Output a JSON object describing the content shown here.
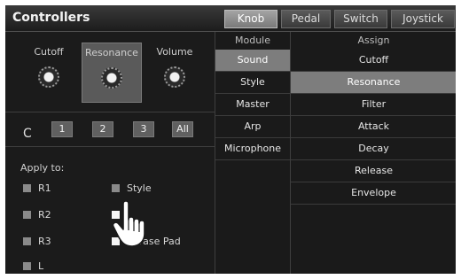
{
  "window": {
    "title": "Controllers"
  },
  "tabs": [
    {
      "label": "Knob",
      "active": true
    },
    {
      "label": "Pedal",
      "active": false
    },
    {
      "label": "Switch",
      "active": false
    },
    {
      "label": "Joystick",
      "active": false
    }
  ],
  "knobs": [
    {
      "label": "Cutoff",
      "selected": false
    },
    {
      "label": "Resonance",
      "selected": true
    },
    {
      "label": "Volume",
      "selected": false
    }
  ],
  "presets": {
    "reset_icon": "C",
    "buttons": [
      "1",
      "2",
      "3",
      "All"
    ]
  },
  "apply": {
    "label": "Apply to:",
    "options": [
      {
        "label": "R1",
        "checked": false
      },
      {
        "label": "Style",
        "checked": false
      },
      {
        "label": "R2",
        "checked": false
      },
      {
        "label": "",
        "checked": false
      },
      {
        "label": "R3",
        "checked": false
      },
      {
        "label": "Phrase Pad",
        "checked": false
      },
      {
        "label": "L",
        "checked": false
      }
    ]
  },
  "assign_table": {
    "module_header": "Module",
    "assign_header": "Assign",
    "modules": [
      "Sound",
      "Style",
      "Master",
      "Arp",
      "Microphone"
    ],
    "selected_module": "Sound",
    "assigns": [
      "Cutoff",
      "Resonance",
      "Filter",
      "Attack",
      "Decay",
      "Release",
      "Envelope"
    ],
    "selected_assign": "Resonance"
  },
  "icons": {
    "refresh": "refresh-icon",
    "pointer": "hand-pointer-icon"
  }
}
